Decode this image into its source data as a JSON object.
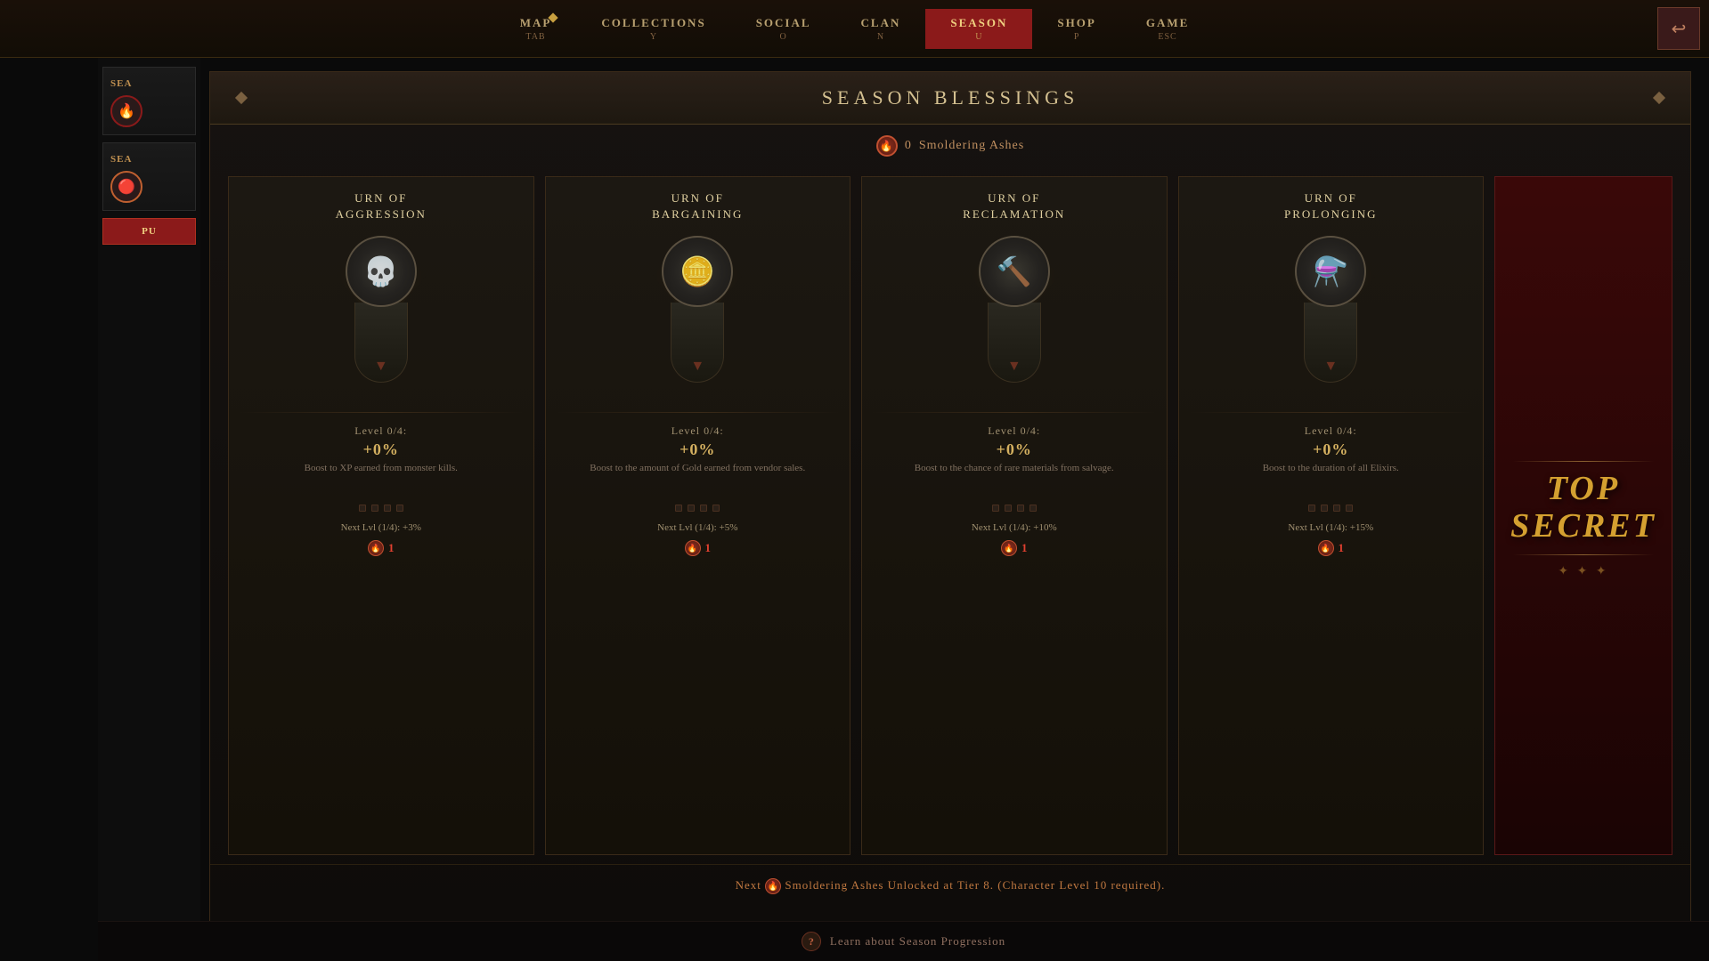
{
  "nav": {
    "items": [
      {
        "label": "MAP",
        "hotkey": "TAB",
        "active": false,
        "has_diamond": true
      },
      {
        "label": "COLLECTIONS",
        "hotkey": "Y",
        "active": false
      },
      {
        "label": "SOCIAL",
        "hotkey": "O",
        "active": false
      },
      {
        "label": "CLAN",
        "hotkey": "N",
        "active": false
      },
      {
        "label": "SEASON",
        "hotkey": "U",
        "active": true
      },
      {
        "label": "SHOP",
        "hotkey": "P",
        "active": false
      },
      {
        "label": "GAME",
        "hotkey": "ESC",
        "active": false
      }
    ],
    "back_symbol": "↩"
  },
  "panel": {
    "title": "SEASON BLESSINGS",
    "ashes_count": "0",
    "ashes_label": "Smoldering Ashes"
  },
  "sidebar": {
    "items": [
      {
        "label": "SEA",
        "icon": "🔥"
      },
      {
        "label": "SEA",
        "icon": "🔴"
      }
    ],
    "button_label": "PU"
  },
  "blessings": [
    {
      "id": "aggression",
      "title_line1": "URN OF",
      "title_line2": "AGGRESSION",
      "icon": "💀",
      "level": "0/4",
      "bonus": "+0%",
      "description": "Boost to XP earned from monster kills.",
      "next_level_text": "Next Lvl (1/4): +3%",
      "cost": "1"
    },
    {
      "id": "bargaining",
      "title_line1": "URN OF",
      "title_line2": "BARGAINING",
      "icon": "🪙",
      "level": "0/4",
      "bonus": "+0%",
      "description": "Boost to the amount of Gold earned from vendor sales.",
      "next_level_text": "Next Lvl (1/4): +5%",
      "cost": "1"
    },
    {
      "id": "reclamation",
      "title_line1": "URN OF",
      "title_line2": "RECLAMATION",
      "icon": "🔨",
      "level": "0/4",
      "bonus": "+0%",
      "description": "Boost to the chance of rare materials from salvage.",
      "next_level_text": "Next Lvl (1/4): +10%",
      "cost": "1"
    },
    {
      "id": "prolonging",
      "title_line1": "URN OF",
      "title_line2": "PROLONGING",
      "icon": "⚗️",
      "level": "0/4",
      "bonus": "+0%",
      "description": "Boost to the duration of all Elixirs.",
      "next_level_text": "Next Lvl (1/4): +15%",
      "cost": "1"
    }
  ],
  "top_secret": {
    "line1": "TOP",
    "line2": "SECRET"
  },
  "footer": {
    "prefix": "Next",
    "suffix": "Smoldering Ashes Unlocked at Tier 8.  (Character Level 10 required)."
  },
  "help": {
    "icon": "?",
    "text": "Learn about Season Progression"
  }
}
